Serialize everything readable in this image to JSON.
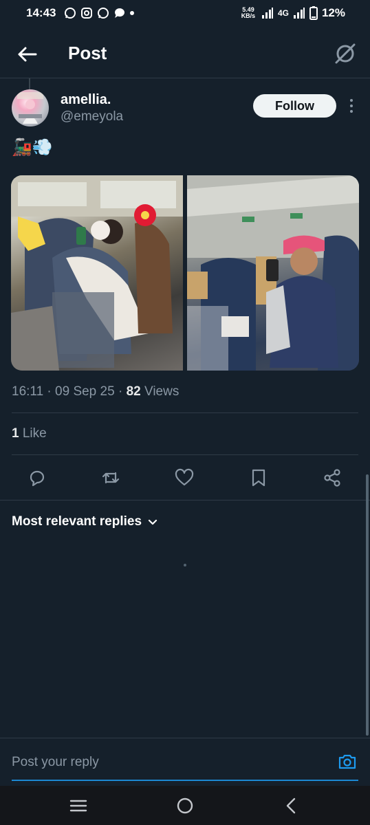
{
  "status_bar": {
    "time": "14:43",
    "net_speed": "5.49",
    "net_speed_unit": "KB/s",
    "network": "4G",
    "battery": "12%",
    "notification_icons": [
      "whatsapp-icon",
      "instagram-icon",
      "whatsapp-icon",
      "chat-bubble-icon"
    ]
  },
  "header": {
    "title": "Post"
  },
  "post": {
    "author_name": "amellia.",
    "author_handle": "@emeyola",
    "follow_label": "Follow",
    "text": "🚂💨",
    "time": "16:11",
    "date": "09 Sep 25",
    "views_count": "82",
    "views_label": "Views",
    "likes_count": "1",
    "likes_label": "Like"
  },
  "actions": [
    "reply-icon",
    "retweet-icon",
    "like-icon",
    "bookmark-icon",
    "share-icon"
  ],
  "replies": {
    "sort_label": "Most relevant replies"
  },
  "reply_box": {
    "placeholder": "Post your reply"
  },
  "colors": {
    "background": "#15202b",
    "accent": "#1d9bf0",
    "muted": "#8b98a5"
  }
}
